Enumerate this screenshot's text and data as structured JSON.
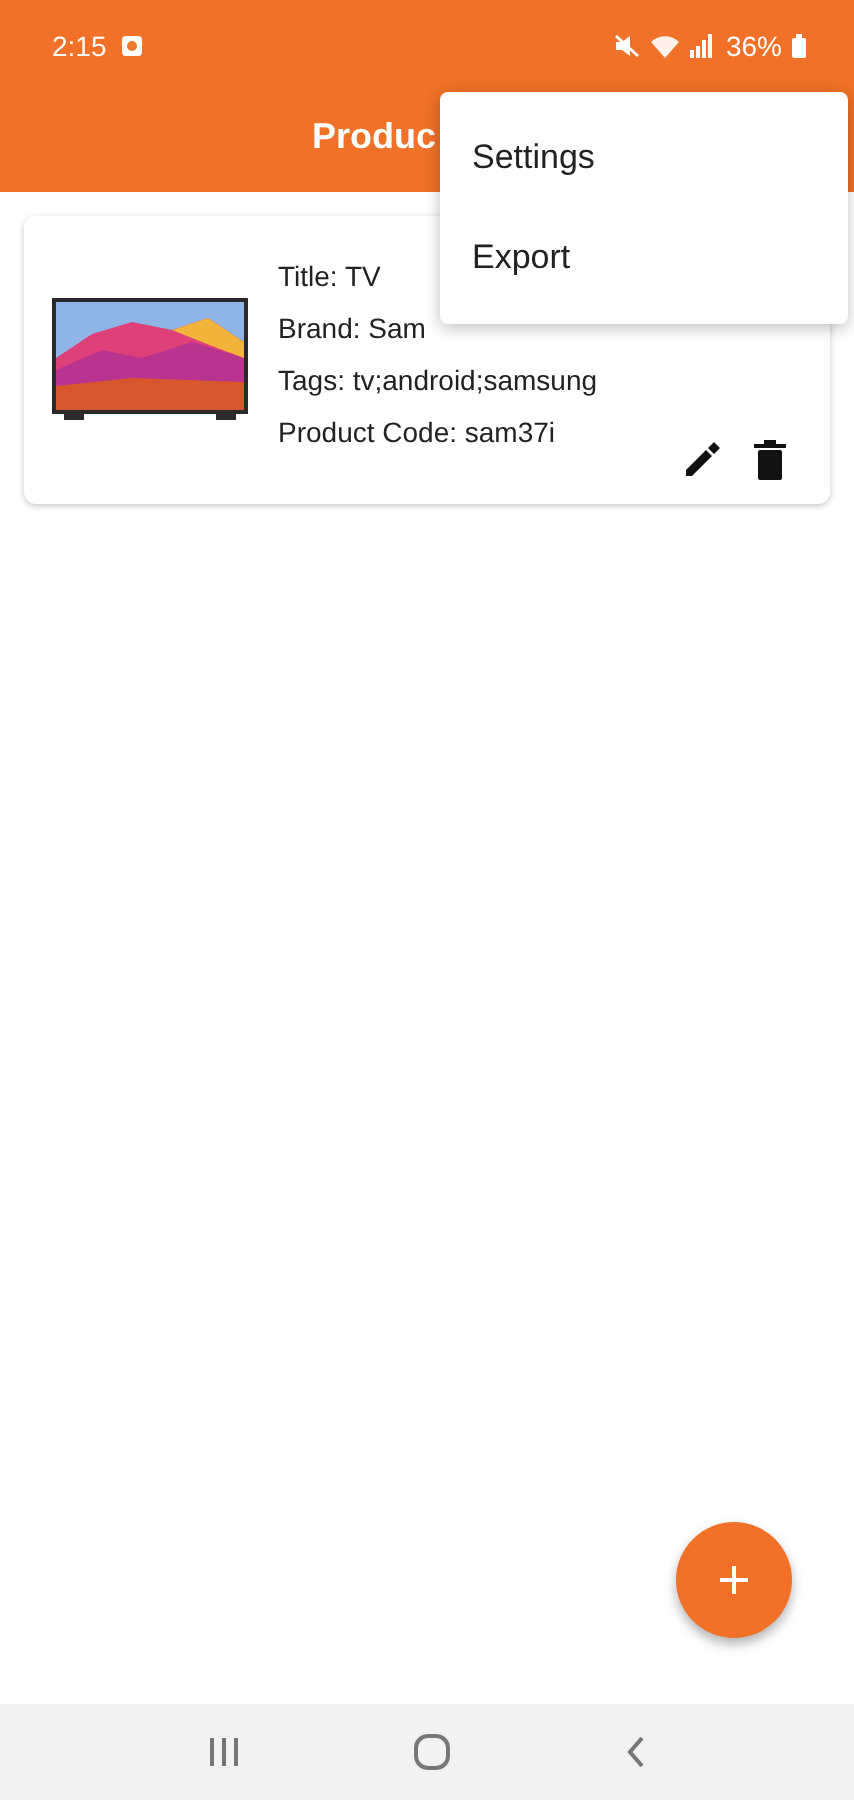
{
  "status_bar": {
    "time": "2:15",
    "battery": "36%"
  },
  "app_bar": {
    "title": "Produc"
  },
  "products": [
    {
      "lines": [
        "Title: TV",
        "Brand: Sam",
        "Tags: tv;android;samsung",
        "Product Code: sam37i"
      ]
    }
  ],
  "menu": {
    "items": [
      {
        "label": "Settings"
      },
      {
        "label": "Export"
      }
    ]
  }
}
